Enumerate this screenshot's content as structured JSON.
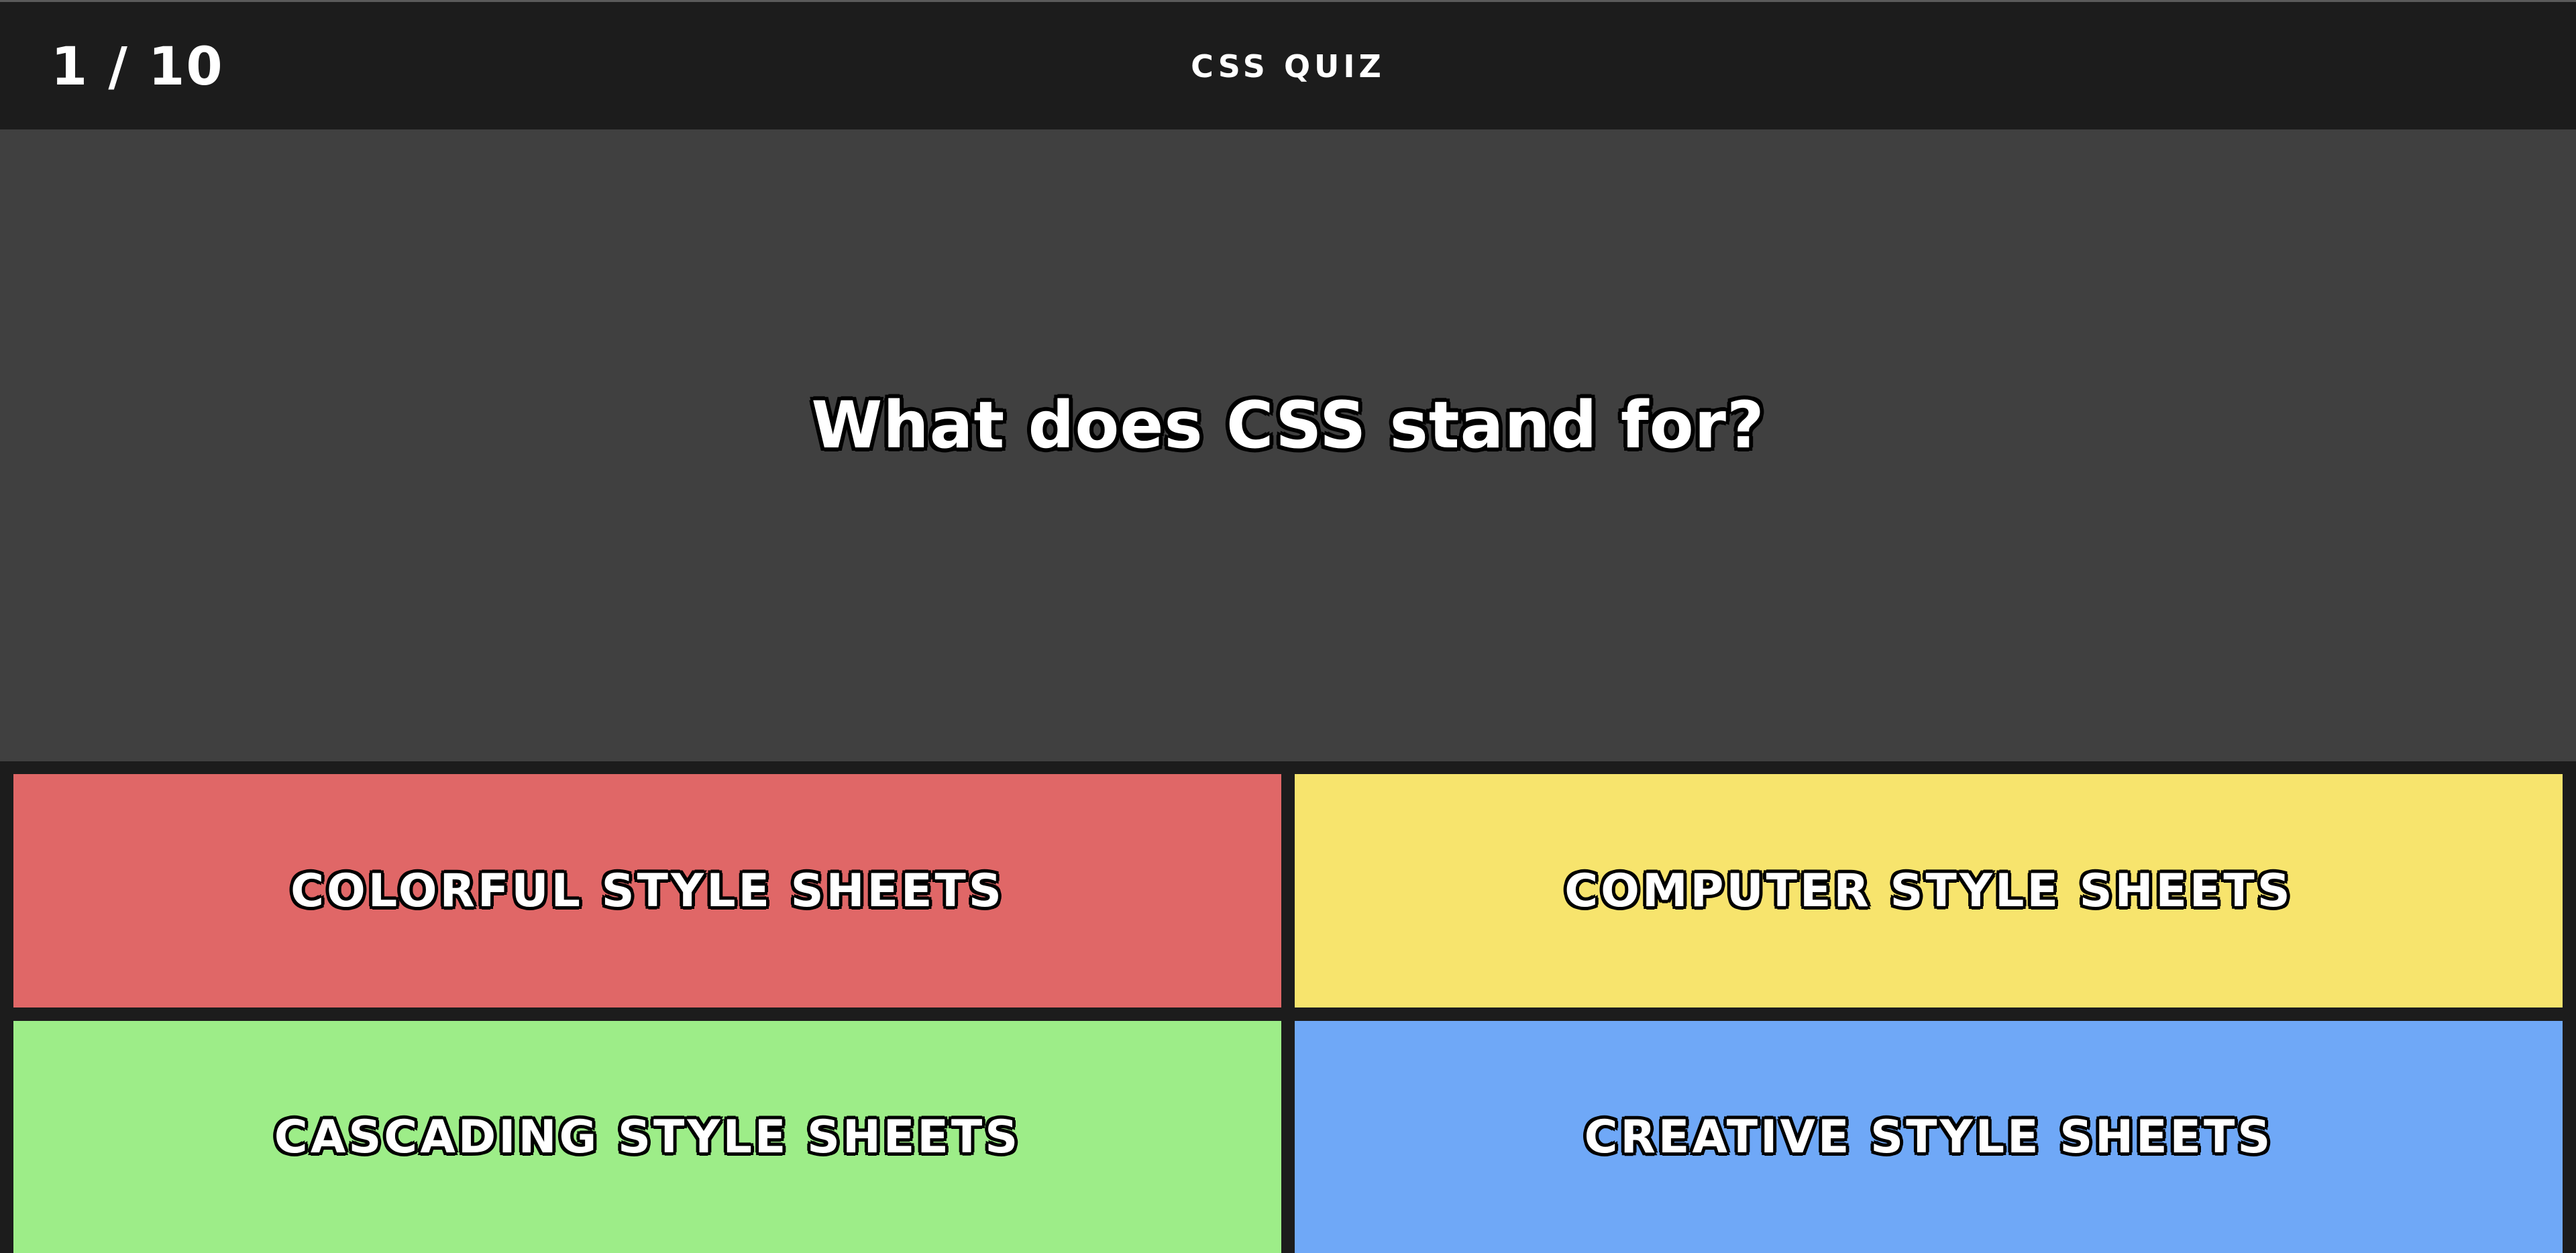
{
  "header": {
    "progress": "1 / 10",
    "title": "CSS QUIZ"
  },
  "question": {
    "text": "What does CSS stand for?"
  },
  "answers": [
    {
      "label": "COLORFUL STYLE SHEETS",
      "color": "#e06767"
    },
    {
      "label": "COMPUTER STYLE SHEETS",
      "color": "#f7e46d"
    },
    {
      "label": "CASCADING STYLE SHEETS",
      "color": "#9ded88"
    },
    {
      "label": "CREATIVE STYLE SHEETS",
      "color": "#6fa8f7"
    }
  ],
  "colors": {
    "header_bg": "#1c1c1c",
    "question_bg": "#404040",
    "text": "#ffffff"
  }
}
